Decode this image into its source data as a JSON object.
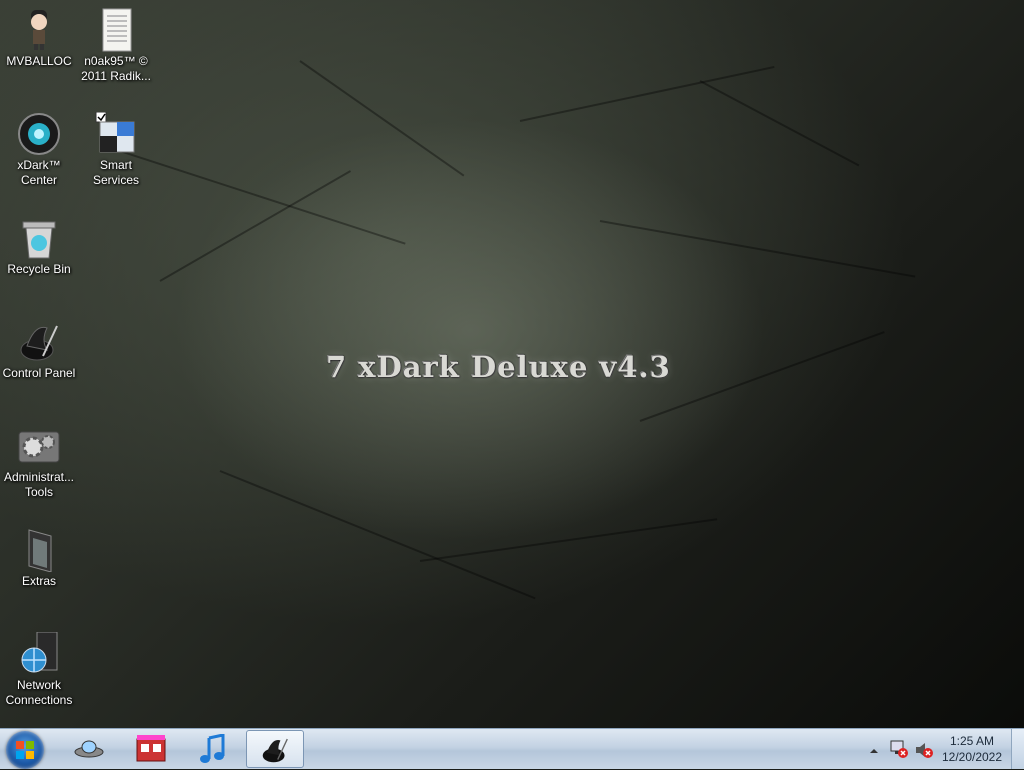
{
  "wallpaper": {
    "title": "7 xDark Deluxe v4.3"
  },
  "desktop_icons": [
    {
      "label": "MVBALLOC",
      "icon": "user-avatar-icon"
    },
    {
      "label": "n0ak95™ ©\n2011 Radik...",
      "icon": "document-icon"
    },
    {
      "label": "xDark™\nCenter",
      "icon": "xdark-center-icon"
    },
    {
      "label": "Smart\nServices",
      "icon": "smart-services-icon"
    },
    {
      "label": "Recycle Bin",
      "icon": "recycle-bin-icon"
    },
    {
      "label": "Control Panel",
      "icon": "control-panel-icon"
    },
    {
      "label": "Administrat...\nTools",
      "icon": "admin-tools-icon"
    },
    {
      "label": "Extras",
      "icon": "folder-icon"
    },
    {
      "label": "Network\nConnections",
      "icon": "network-icon"
    }
  ],
  "taskbar": {
    "pinned": [
      "ufo-app-icon",
      "film-store-icon",
      "music-note-icon",
      "control-panel-icon"
    ],
    "tray_icons": [
      "show-hidden-icons-chevron",
      "network-status-icon",
      "volume-muted-icon"
    ],
    "time": "1:25 AM",
    "date": "12/20/2022"
  }
}
